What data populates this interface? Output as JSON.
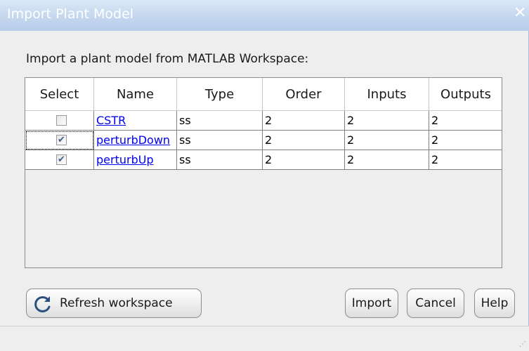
{
  "window": {
    "title": "Import Plant Model",
    "close_glyph": "✕"
  },
  "instruction": "Import a plant model from MATLAB Workspace:",
  "table": {
    "columns": [
      "Select",
      "Name",
      "Type",
      "Order",
      "Inputs",
      "Outputs"
    ],
    "rows": [
      {
        "selected": false,
        "name": "CSTR",
        "type": "ss",
        "order": "2",
        "inputs": "2",
        "outputs": "2"
      },
      {
        "selected": true,
        "name": "perturbDown",
        "type": "ss",
        "order": "2",
        "inputs": "2",
        "outputs": "2"
      },
      {
        "selected": true,
        "name": "perturbUp",
        "type": "ss",
        "order": "2",
        "inputs": "2",
        "outputs": "2"
      }
    ]
  },
  "buttons": {
    "refresh": {
      "label": "Refresh workspace",
      "icon": "refresh-icon"
    },
    "import": "Import",
    "cancel": "Cancel",
    "help": "Help"
  },
  "checkmark_glyph": "✔",
  "grip_glyph": "⋰",
  "colors": {
    "titlebar": "#c4d7ee",
    "link": "#0000ee",
    "background": "#eeeeee"
  }
}
